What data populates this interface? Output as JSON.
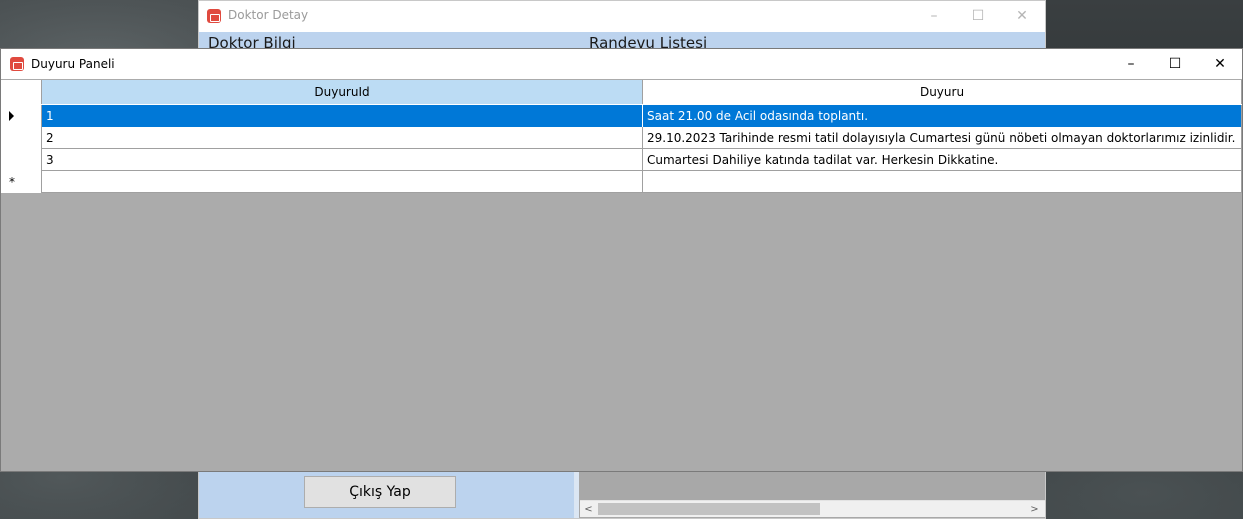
{
  "background_window": {
    "title": "Doktor Detay",
    "tabs": [
      "Doktor Bilgi",
      "Randevu Listesi"
    ],
    "exit_button": "Çıkış Yap",
    "controls": {
      "minimize": "–",
      "maximize": "☐",
      "close": "✕"
    },
    "scroll_left": "<",
    "scroll_right": ">"
  },
  "window": {
    "title": "Duyuru Paneli",
    "controls": {
      "minimize": "–",
      "maximize": "☐",
      "close": "✕"
    }
  },
  "grid": {
    "columns": [
      "DuyuruId",
      "Duyuru"
    ],
    "rows": [
      {
        "id": "1",
        "text": "Saat 21.00 de Acil odasında toplantı.",
        "selected": true
      },
      {
        "id": "2",
        "text": "29.10.2023 Tarihinde resmi tatil dolayısıyla Cumartesi günü nöbeti olmayan doktorlarımız izinlidir.",
        "selected": false
      },
      {
        "id": "3",
        "text": "Cumartesi Dahiliye katında tadilat var. Herkesin Dikkatine.",
        "selected": false
      }
    ],
    "new_row_marker": "*"
  },
  "colors": {
    "selection": "#0078d7",
    "selected_header": "#bcdcf4",
    "grid_background": "#ababab",
    "app_icon": "#e04a3f"
  },
  "icons": {
    "app": "medical-kit-icon",
    "row_pointer": "triangle-right-icon"
  }
}
